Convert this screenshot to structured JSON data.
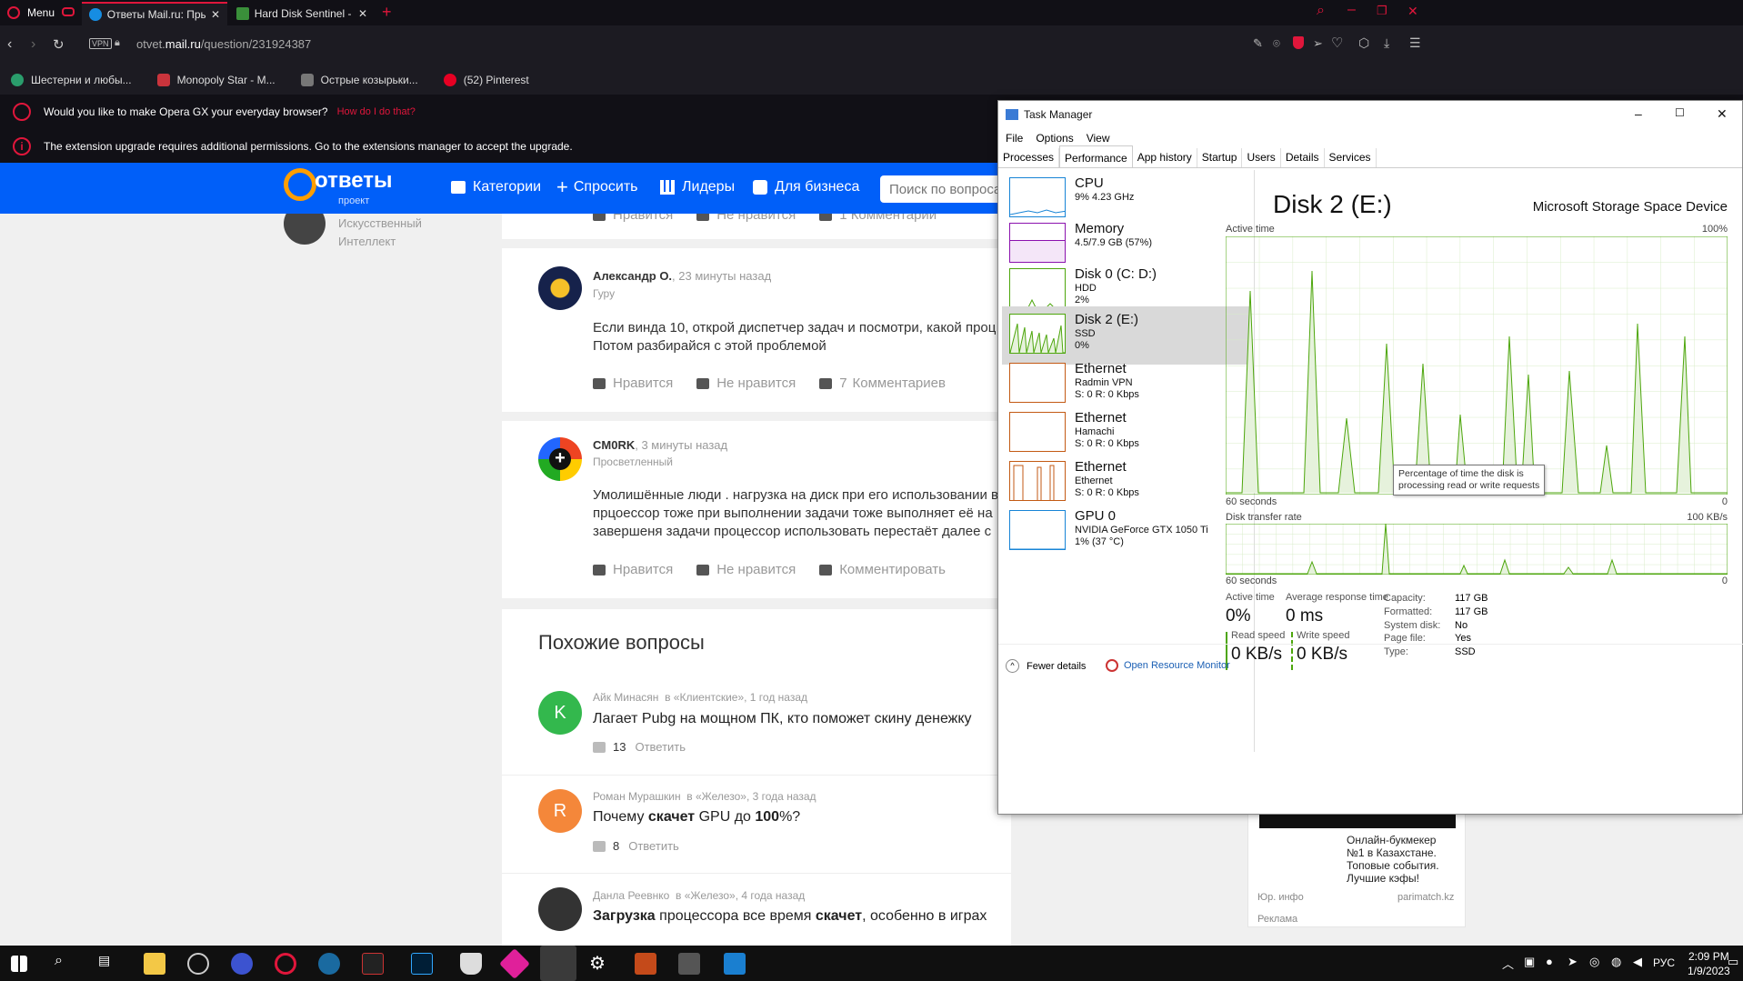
{
  "browser": {
    "menu_label": "Menu",
    "tabs": [
      {
        "title": "Ответы Mail.ru: Прыгает д"
      },
      {
        "title": "Hard Disk Sentinel - Thank"
      }
    ],
    "vpn_badge": "VPN",
    "url_prefix": "otvet.",
    "url_domain": "mail.ru",
    "url_path": "/question/231924387",
    "bookmarks": [
      {
        "label": "Шестерни и любы..."
      },
      {
        "label": "Monopoly Star - M..."
      },
      {
        "label": "Острые козырьки..."
      },
      {
        "label": "(52) Pinterest"
      }
    ],
    "notice1": "Would you like to make Opera GX your everyday browser?",
    "notice1_link": "How do I do that?",
    "notice2": "The extension upgrade requires additional permissions. Go to the extensions manager to accept the upgrade."
  },
  "site": {
    "logo_text": "ответы",
    "logo_sub": "проект",
    "nav": {
      "categories": "Категории",
      "ask": "Спросить",
      "leaders": "Лидеры",
      "business": "Для бизнеса"
    },
    "search_placeholder": "Поиск по вопроса",
    "top_user": {
      "line1": "Искусственный",
      "line2": "Интеллект"
    },
    "top_actions": {
      "like": "Нравится",
      "dislike": "Не нравится",
      "comments": "1 Комментарии"
    },
    "answers": [
      {
        "name": "Александр О.",
        "time": ", 23 минуты назад",
        "rank": "Гуру",
        "line1": "Если винда 10, открой диспетчер задач и посмотри, какой проц",
        "line2": "Потом разбирайся с этой проблемой",
        "like": "Нравится",
        "dislike": "Не нравится",
        "comments_count": "7",
        "comments": "Комментариев"
      },
      {
        "name": "CM0RK",
        "time": ", 3 минуты назад",
        "rank": "Просветленный",
        "line1": "Умолишённые люди . нагрузка на диск при его использовании в",
        "line2": "прцоессор тоже при выполнении задачи тоже выполняет её на",
        "line3": "завершеня задачи процессор использовать перестаёт далее с",
        "like": "Нравится",
        "dislike": "Не нравится",
        "comments": "Комментировать"
      }
    ],
    "similar_title": "Похожие вопросы",
    "similar": [
      {
        "avatar_letter": "K",
        "author": "Айк Минасян",
        "cat": "в «Клиентские», 1 год назад",
        "title": "Лагает Pubg на мощном ПК, кто поможет скину денежку",
        "count": "13",
        "reply": "Ответить"
      },
      {
        "avatar_letter": "R",
        "author": "Роман Мурашкин",
        "cat": "в «Железо», 3 года назад",
        "t1": "Почему ",
        "t2": "скачет",
        "t3": " GPU до ",
        "t4": "100",
        "t5": "%?",
        "count": "8",
        "reply": "Ответить"
      },
      {
        "author": "Данла Реевнко",
        "cat": "в «Железо», 4 года назад",
        "t1": "Загрузка",
        "t2": " процессора все время ",
        "t3": "скачет",
        "t4": ", особенно в играх"
      }
    ],
    "ad": {
      "text1": "Онлайн-букмекер",
      "text2": "№1 в Казахстане.",
      "text3": "Топовые события.",
      "text4": "Лучшие кэфы!",
      "left": "Юр. инфо",
      "right": "parimatch.kz",
      "label": "Реклама"
    }
  },
  "taskmanager": {
    "title": "Task Manager",
    "menu": [
      "File",
      "Options",
      "View"
    ],
    "tabs": [
      "Processes",
      "Performance",
      "App history",
      "Startup",
      "Users",
      "Details",
      "Services"
    ],
    "items": [
      {
        "title": "CPU",
        "s1": "9% 4.23 GHz",
        "s2": ""
      },
      {
        "title": "Memory",
        "s1": "4.5/7.9 GB (57%)",
        "s2": ""
      },
      {
        "title": "Disk 0 (C: D:)",
        "s1": "HDD",
        "s2": "2%"
      },
      {
        "title": "Disk 2 (E:)",
        "s1": "SSD",
        "s2": "0%"
      },
      {
        "title": "Ethernet",
        "s1": "Radmin VPN",
        "s2": "S: 0 R: 0 Kbps"
      },
      {
        "title": "Ethernet",
        "s1": "Hamachi",
        "s2": "S: 0 R: 0 Kbps"
      },
      {
        "title": "Ethernet",
        "s1": "Ethernet",
        "s2": "S: 0 R: 0 Kbps"
      },
      {
        "title": "GPU 0",
        "s1": "NVIDIA GeForce GTX 1050 Ti",
        "s2": "1% (37 °C)"
      }
    ],
    "detail": {
      "heading": "Disk 2 (E:)",
      "device": "Microsoft Storage Space Device",
      "active_time_label": "Active time",
      "active_max": "100%",
      "x_left": "60 seconds",
      "x_right": "0",
      "tooltip1": "Percentage of time the disk is",
      "tooltip2": "processing read or write requests",
      "transfer_label": "Disk transfer rate",
      "transfer_max": "100 KB/s",
      "x2_left": "60 seconds",
      "x2_right": "0",
      "active_time": "Active time",
      "active_value": "0%",
      "avg_resp": "Average response time",
      "avg_value": "0 ms",
      "read_label": "Read speed",
      "read_value": "0 KB/s",
      "write_label": "Write speed",
      "write_value": "0 KB/s",
      "props": [
        {
          "k": "Capacity:",
          "v": "117 GB"
        },
        {
          "k": "Formatted:",
          "v": "117 GB"
        },
        {
          "k": "System disk:",
          "v": "No"
        },
        {
          "k": "Page file:",
          "v": "Yes"
        },
        {
          "k": "Type:",
          "v": "SSD"
        }
      ]
    },
    "fewer": "Fewer details",
    "resmon": "Open Resource Monitor"
  },
  "taskbar": {
    "lang": "РУС",
    "time": "2:09 PM",
    "date": "1/9/2023"
  },
  "colors": {
    "opera_red": "#e0163b",
    "mail_blue": "#005ff9",
    "disk_green": "#4da60c"
  }
}
